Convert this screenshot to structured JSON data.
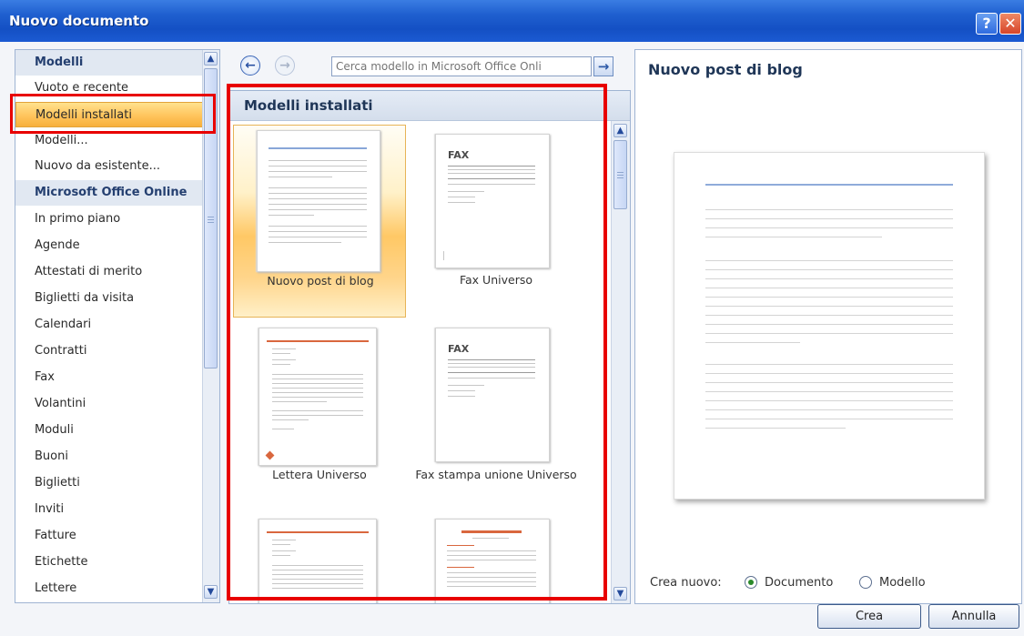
{
  "window": {
    "title": "Nuovo documento",
    "help_label": "?",
    "close_label": "✕"
  },
  "categories": [
    {
      "label": "Modelli",
      "type": "header"
    },
    {
      "label": "Vuoto e recente",
      "type": "item"
    },
    {
      "label": "Modelli installati",
      "type": "item",
      "selected": true
    },
    {
      "label": "Modelli...",
      "type": "item"
    },
    {
      "label": "Nuovo da esistente...",
      "type": "item"
    },
    {
      "label": "Microsoft Office Online",
      "type": "header"
    },
    {
      "label": "In primo piano",
      "type": "item"
    },
    {
      "label": "Agende",
      "type": "item"
    },
    {
      "label": "Attestati di merito",
      "type": "item"
    },
    {
      "label": "Biglietti da visita",
      "type": "item"
    },
    {
      "label": "Calendari",
      "type": "item"
    },
    {
      "label": "Contratti",
      "type": "item"
    },
    {
      "label": "Fax",
      "type": "item"
    },
    {
      "label": "Volantini",
      "type": "item"
    },
    {
      "label": "Moduli",
      "type": "item"
    },
    {
      "label": "Buoni",
      "type": "item"
    },
    {
      "label": "Biglietti",
      "type": "item"
    },
    {
      "label": "Inviti",
      "type": "item"
    },
    {
      "label": "Fatture",
      "type": "item"
    },
    {
      "label": "Etichette",
      "type": "item"
    },
    {
      "label": "Lettere",
      "type": "item"
    }
  ],
  "search": {
    "placeholder": "Cerca modello in Microsoft Office Onli",
    "back_icon": "arrow-left-icon",
    "forward_icon": "arrow-right-icon",
    "go_icon": "arrow-right-icon"
  },
  "templates_section": {
    "title": "Modelli installati",
    "items": [
      {
        "label": "Nuovo post di blog",
        "selected": true
      },
      {
        "label": "Fax Universo"
      },
      {
        "label": "Lettera Universo"
      },
      {
        "label": "Fax stampa unione Universo"
      },
      {
        "label": ""
      },
      {
        "label": ""
      }
    ],
    "fax_text": "FAX"
  },
  "preview": {
    "title": "Nuovo post di blog",
    "create_new_label": "Crea nuovo:",
    "options": [
      {
        "label": "Documento",
        "checked": true
      },
      {
        "label": "Modello",
        "checked": false
      }
    ]
  },
  "buttons": {
    "create": "Crea",
    "cancel": "Annulla"
  },
  "colors": {
    "titlebar": "#1f5fcf",
    "selection": "#ffc45c",
    "highlight": "#e80000"
  }
}
